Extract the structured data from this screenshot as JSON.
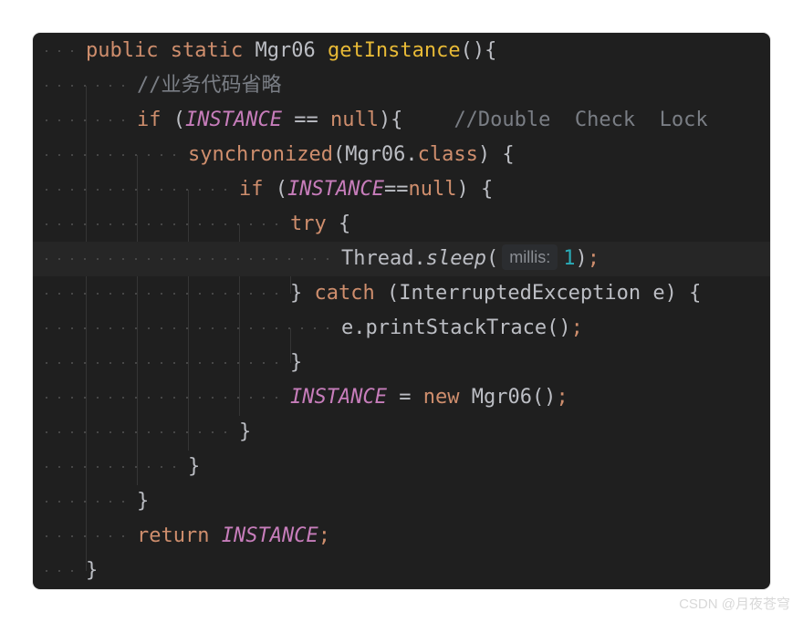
{
  "code": {
    "l1": {
      "public": "public",
      "static": "static",
      "type": "Mgr06",
      "method": "getInstance",
      "rest": "(){"
    },
    "l2": {
      "comment": "//业务代码省略"
    },
    "l3": {
      "if": "if",
      "open": " (",
      "inst": "INSTANCE",
      "op": " == ",
      "null": "null",
      "close": "){",
      "comment": "//Double  Check  Lock"
    },
    "l4": {
      "sync": "synchronized",
      "arg": "(Mgr06.",
      "class": "class",
      "close": ") {"
    },
    "l5": {
      "if": "if",
      "open": " (",
      "inst": "INSTANCE",
      "op": "==",
      "null": "null",
      "close": ") {"
    },
    "l6": {
      "try": "try",
      "brace": " {"
    },
    "l7": {
      "obj": "Thread.",
      "method": "sleep",
      "open": "(",
      "hint": "millis:",
      "num": "1",
      "close": ")",
      "semi": ";"
    },
    "l8": {
      "brace": "} ",
      "catch": "catch",
      "rest": " (InterruptedException e) {"
    },
    "l9": {
      "call": "e.printStackTrace()",
      "semi": ";"
    },
    "l10": {
      "brace": "}"
    },
    "l11": {
      "inst": "INSTANCE",
      "eq": " = ",
      "new": "new",
      "ctor": " Mgr06()",
      "semi": ";"
    },
    "l12": {
      "brace": "}"
    },
    "l13": {
      "brace": "}"
    },
    "l14": {
      "brace": "}"
    },
    "l15": {
      "return": "return",
      "inst": "INSTANCE",
      "semi": ";"
    },
    "l16": {
      "brace": "}"
    }
  },
  "watermark": "CSDN @月夜苍穹"
}
